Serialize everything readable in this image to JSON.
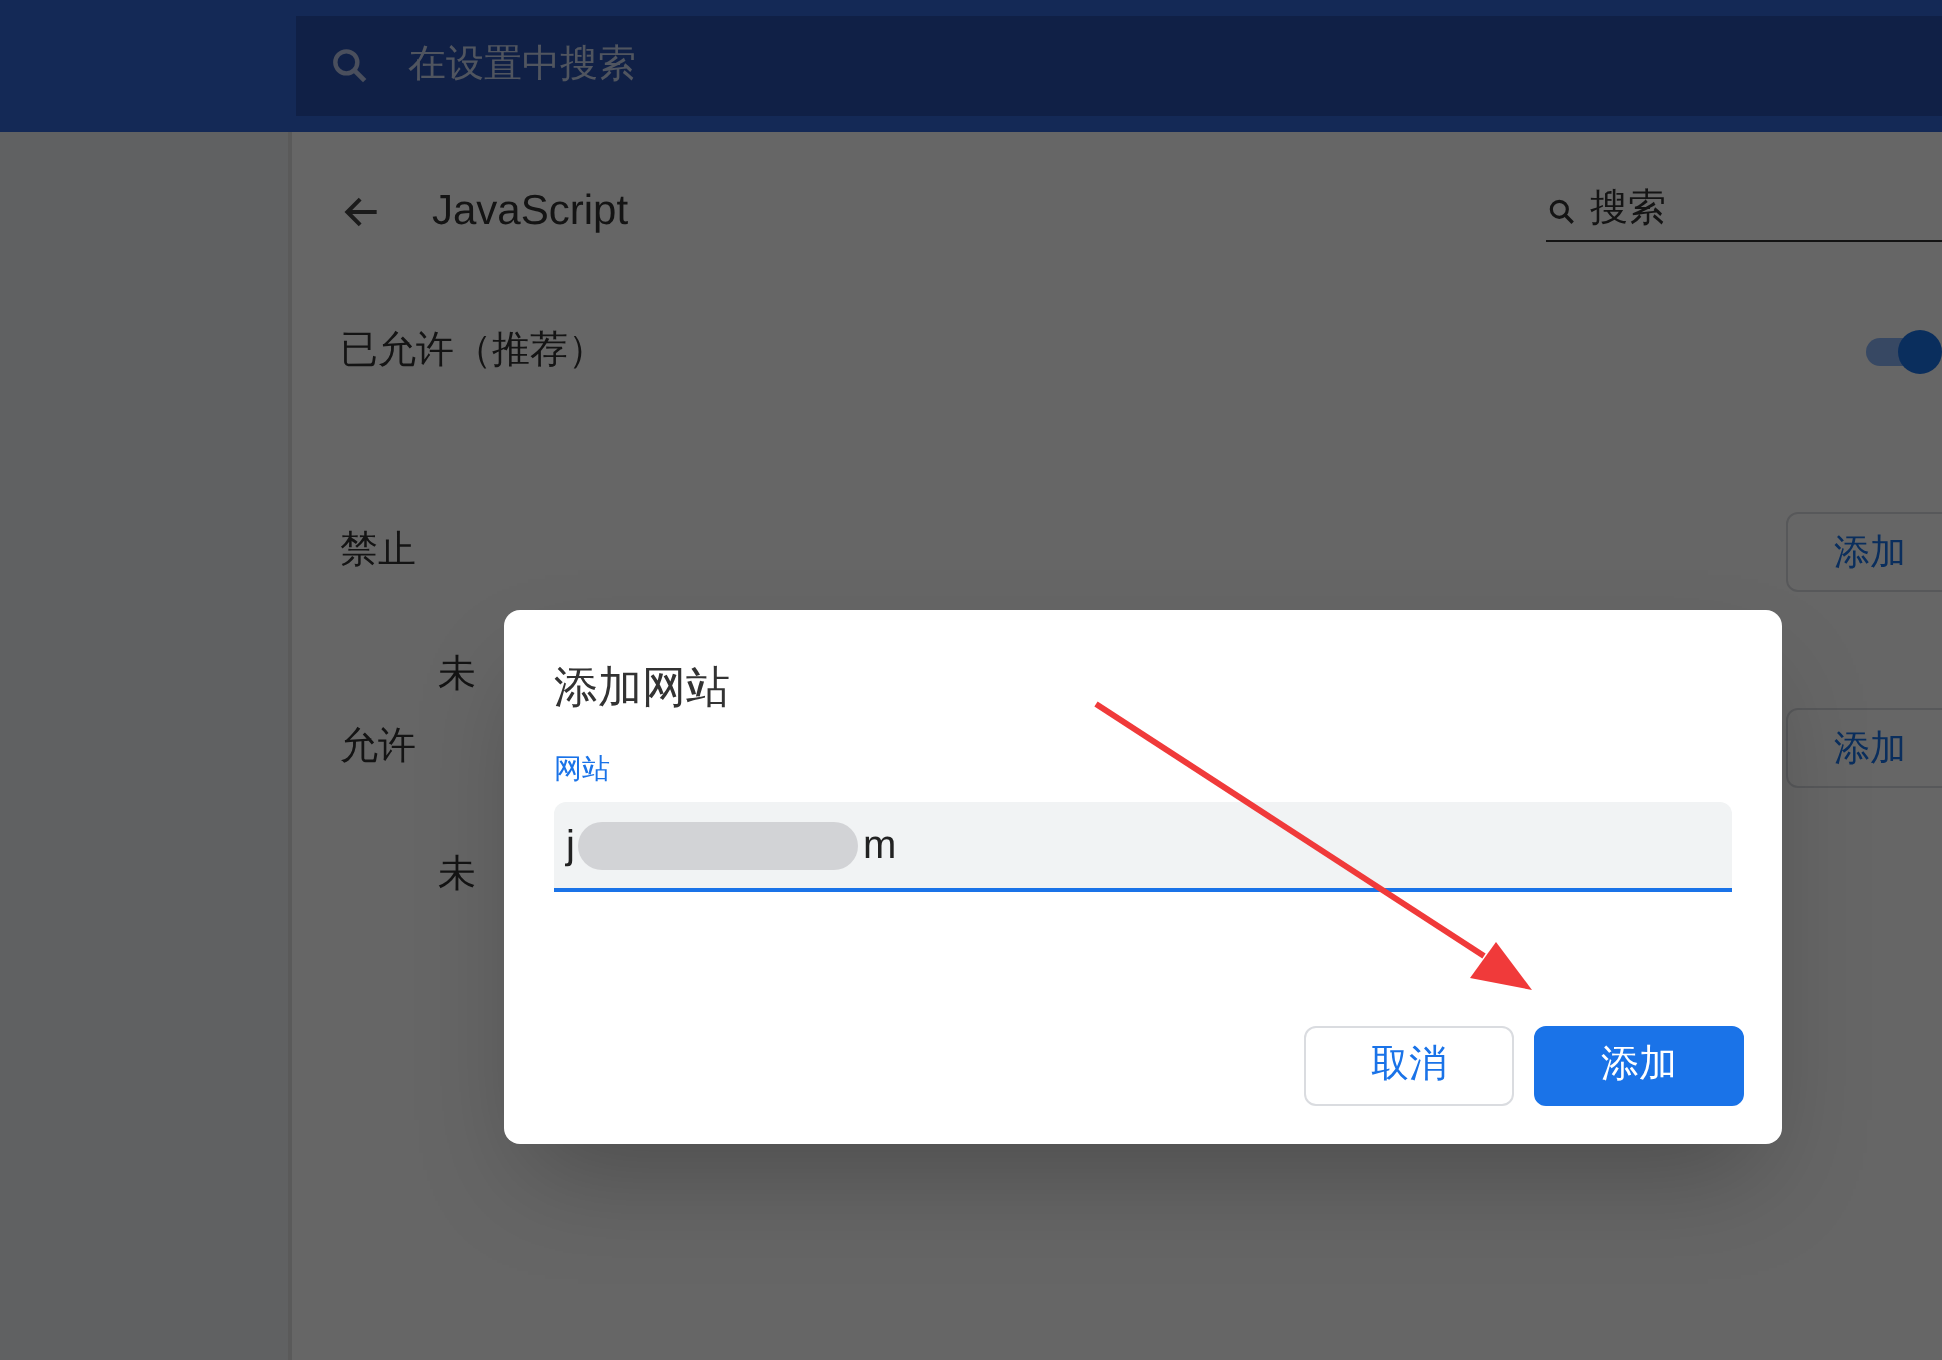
{
  "top_bar": {
    "search": {
      "placeholder": "在设置中搜索"
    }
  },
  "page": {
    "title": "JavaScript",
    "search": {
      "value": "搜索"
    },
    "allowed_setting": {
      "label": "已允许（推荐）",
      "on": true
    },
    "sections": [
      {
        "title": "禁止",
        "button": "添加",
        "empty": "未"
      },
      {
        "title": "允许",
        "button": "添加",
        "empty": "未"
      }
    ]
  },
  "dialog": {
    "title": "添加网站",
    "field": {
      "label": "网站",
      "value_start": "j",
      "value_end": "m",
      "redacted": true
    },
    "buttons": [
      {
        "label": "取消",
        "kind": "secondary"
      },
      {
        "label": "添加",
        "kind": "primary"
      }
    ]
  },
  "annotation": {
    "kind": "arrow"
  }
}
